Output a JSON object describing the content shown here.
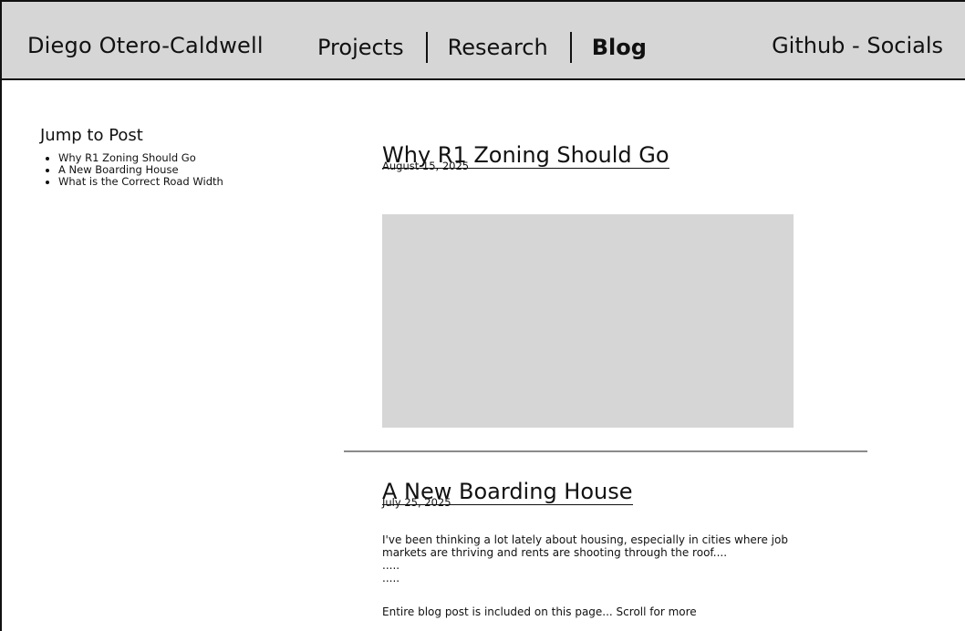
{
  "header": {
    "site_name": "Diego Otero-Caldwell",
    "nav": {
      "projects": "Projects",
      "research": "Research",
      "blog": "Blog"
    },
    "socials": "Github - Socials"
  },
  "sidebar": {
    "heading": "Jump to Post",
    "items": [
      {
        "label": "Why R1 Zoning Should Go"
      },
      {
        "label": "A New Boarding House"
      },
      {
        "label": "What is the Correct Road Width"
      }
    ]
  },
  "posts": [
    {
      "title": "Why R1 Zoning Should Go",
      "date": "August 15, 2025"
    },
    {
      "title": "A New Boarding House",
      "date": "July 25, 2025",
      "excerpt": "I've been thinking a lot lately about housing, especially in cities where job markets are thriving and rents are shooting through the roof....",
      "ellipsis_1": ".....",
      "ellipsis_2": "....."
    }
  ],
  "footer_note": "Entire blog post is included on this page... Scroll for more",
  "colors": {
    "header_bg": "#d6d6d6",
    "image_placeholder": "#d6d6d6",
    "divider": "#8a8a8a",
    "text": "#111111"
  }
}
